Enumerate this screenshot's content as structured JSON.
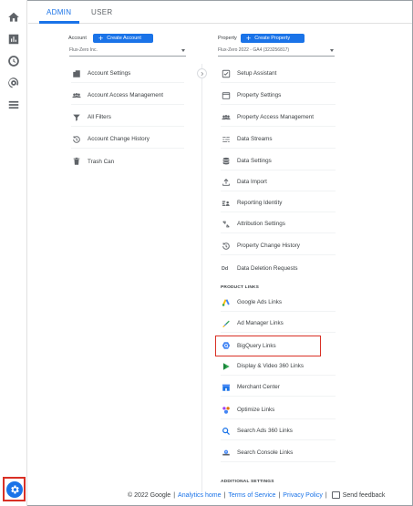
{
  "tabs": {
    "admin": "ADMIN",
    "user": "USER"
  },
  "account": {
    "label": "Account",
    "create_label": "Create Account",
    "selected": "Flux-Zero Inc.",
    "items": [
      {
        "label": "Account Settings",
        "icon": "building-icon"
      },
      {
        "label": "Account Access Management",
        "icon": "people-icon"
      },
      {
        "label": "All Filters",
        "icon": "filter-icon"
      },
      {
        "label": "Account Change History",
        "icon": "history-icon"
      },
      {
        "label": "Trash Can",
        "icon": "trash-icon"
      }
    ]
  },
  "property": {
    "label": "Property",
    "create_label": "Create Property",
    "selected": "Flux-Zero 2022 - GA4 (323256817)",
    "items": [
      {
        "label": "Setup Assistant",
        "icon": "checkbox-icon"
      },
      {
        "label": "Property Settings",
        "icon": "settings-window-icon"
      },
      {
        "label": "Property Access Management",
        "icon": "people-icon"
      },
      {
        "label": "Data Streams",
        "icon": "streams-icon"
      },
      {
        "label": "Data Settings",
        "icon": "database-icon"
      },
      {
        "label": "Data Import",
        "icon": "upload-icon"
      },
      {
        "label": "Reporting Identity",
        "icon": "identity-icon"
      },
      {
        "label": "Attribution Settings",
        "icon": "attribution-icon"
      },
      {
        "label": "Property Change History",
        "icon": "history-icon"
      },
      {
        "label": "Data Deletion Requests",
        "icon": "dd-icon"
      }
    ],
    "product_links_heading": "PRODUCT LINKS",
    "product_links": [
      {
        "label": "Google Ads Links",
        "icon": "google-ads-icon"
      },
      {
        "label": "Ad Manager Links",
        "icon": "ad-manager-icon"
      },
      {
        "label": "BigQuery Links",
        "icon": "bigquery-icon"
      },
      {
        "label": "Display & Video 360 Links",
        "icon": "dv360-icon"
      },
      {
        "label": "Merchant Center",
        "icon": "merchant-center-icon"
      },
      {
        "label": "Optimize Links",
        "icon": "optimize-icon"
      },
      {
        "label": "Search Ads 360 Links",
        "icon": "search-ads-icon"
      },
      {
        "label": "Search Console Links",
        "icon": "search-console-icon"
      }
    ],
    "additional_heading": "ADDITIONAL SETTINGS"
  },
  "footer": {
    "copyright": "© 2022 Google",
    "analytics_home": "Analytics home",
    "terms": "Terms of Service",
    "privacy": "Privacy Policy",
    "feedback": "Send feedback"
  },
  "colors": {
    "accent": "#1a73e8",
    "highlight": "#d93025"
  }
}
